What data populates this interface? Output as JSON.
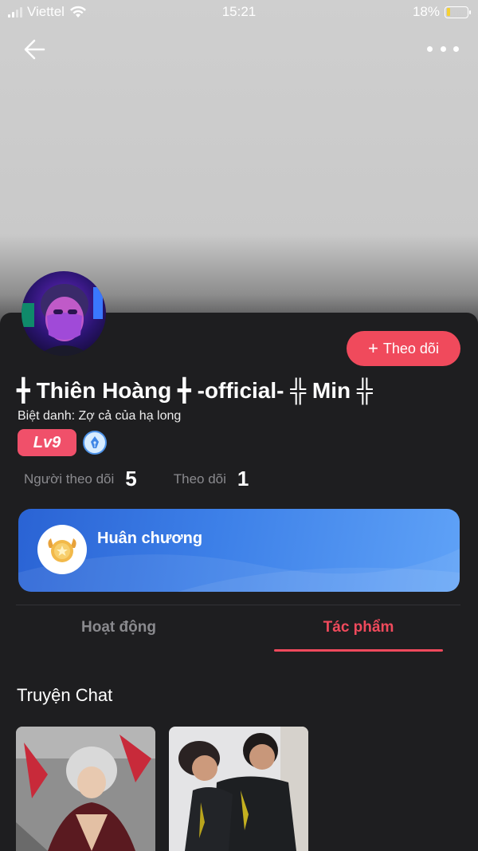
{
  "status_bar": {
    "carrier": "Viettel",
    "time": "15:21",
    "battery": "18%",
    "battery_level": 0.18
  },
  "nav": {
    "back_icon": "arrow-left-icon",
    "more_icon": "more-horizontal-icon"
  },
  "profile": {
    "name": "╋ Thiên Hoàng ╋ -official- ╬ Min ╬",
    "nickname": "Biệt danh: Zợ cả của hạ long",
    "level": "Lv9",
    "follow_button": "Theo dõi",
    "follow_icon": "plus-icon"
  },
  "stats": {
    "followers_label": "Người theo dõi",
    "followers_value": "5",
    "following_label": "Theo dõi",
    "following_value": "1"
  },
  "medal_card": {
    "title": "Huân chương",
    "icon": "medal-icon"
  },
  "tabs": [
    {
      "label": "Hoạt động",
      "active": false
    },
    {
      "label": "Tác phẩm",
      "active": true
    }
  ],
  "section": {
    "title": "Truyện Chat"
  },
  "colors": {
    "accent": "#f04a5c",
    "background": "#1e1e20",
    "card_blue": "#3d80e8"
  }
}
